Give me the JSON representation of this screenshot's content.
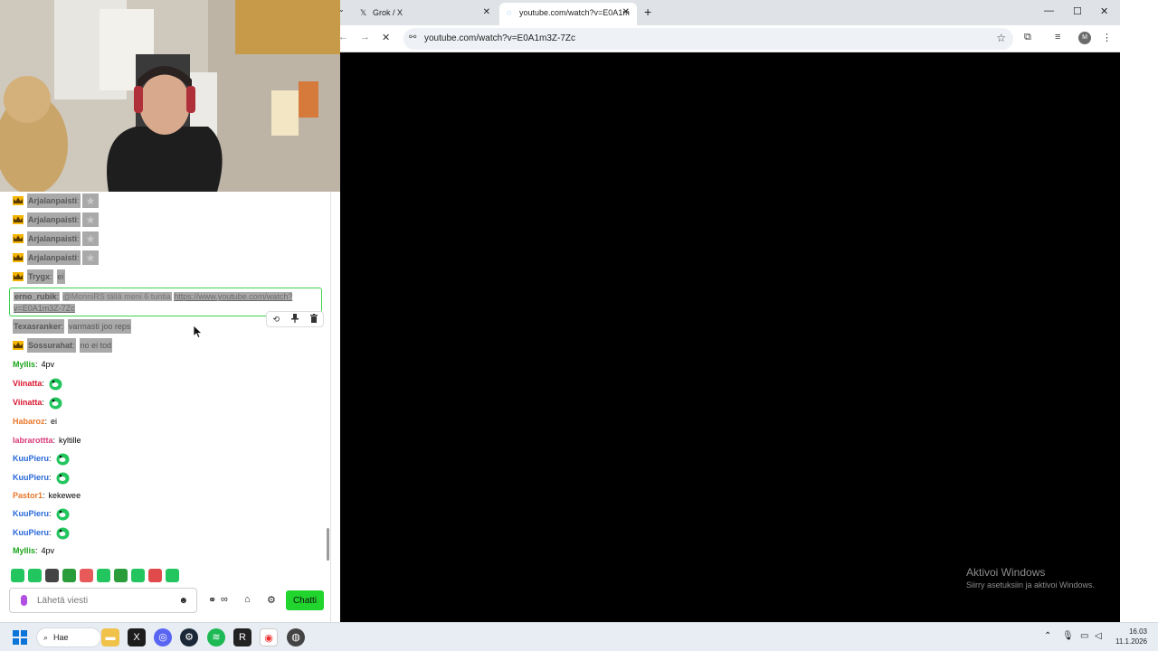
{
  "chat": {
    "messages": [
      {
        "user": "Arjalanpaisti",
        "sep": ":",
        "text": "",
        "emote": "star-emote",
        "crown": true,
        "highlight": true
      },
      {
        "user": "Arjalanpaisti",
        "sep": ":",
        "text": "",
        "emote": "star-emote",
        "crown": true,
        "highlight": true
      },
      {
        "user": "Arjalanpaisti",
        "sep": ":",
        "text": "",
        "emote": "star-emote",
        "crown": true,
        "highlight": true
      },
      {
        "user": "Arjalanpaisti",
        "sep": ":",
        "text": "",
        "emote": "star-emote",
        "crown": true,
        "highlight": true
      },
      {
        "user": "Trygx",
        "sep": ":",
        "text": "ei",
        "crown": true,
        "highlight": true
      },
      {
        "user": "Texasranker",
        "sep": ":",
        "text": "varmasti joo reps",
        "crown": false,
        "highlight": true
      },
      {
        "user": "Sossurahat",
        "sep": ":",
        "text": "no ei tod",
        "crown": true,
        "highlight": true
      },
      {
        "user": "Myllis",
        "sep": ":",
        "text": "4pv",
        "color": "#1aa51a"
      },
      {
        "user": "Viinatta",
        "sep": ":",
        "text": "",
        "emote": "pepega-emote",
        "color": "#d8142e"
      },
      {
        "user": "Viinatta",
        "sep": ":",
        "text": "",
        "emote": "pepega-emote",
        "color": "#d8142e"
      },
      {
        "user": "Habaroz",
        "sep": ":",
        "text": "ei",
        "color": "#e8772a"
      },
      {
        "user": "labrarottta",
        "sep": ":",
        "text": "kyltille",
        "color": "#d83a7a"
      },
      {
        "user": "KuuPieru",
        "sep": ":",
        "text": "",
        "emote": "pepega-emote",
        "color": "#2a6ad8"
      },
      {
        "user": "KuuPieru",
        "sep": ":",
        "text": "",
        "emote": "pepega-emote",
        "color": "#2a6ad8"
      },
      {
        "user": "Pastor1",
        "sep": ":",
        "text": "kekewee",
        "color": "#e8772a"
      },
      {
        "user": "KuuPieru",
        "sep": ":",
        "text": "",
        "emote": "pepega-emote",
        "color": "#2a6ad8"
      },
      {
        "user": "KuuPieru",
        "sep": ":",
        "text": "",
        "emote": "pepega-emote",
        "color": "#2a6ad8"
      },
      {
        "user": "Myllis",
        "sep": ":",
        "text": "4pv",
        "color": "#1aa51a"
      }
    ],
    "pinned": {
      "user": "erno_rubik",
      "sep": ":",
      "text": "@MonniRS tällä meni 6 tuntia",
      "link_part1": "https://www.youtube.com/watch?",
      "link_part2": "v=E0A1m3Z-7Zc"
    },
    "actions": {
      "undo": "⟲",
      "pin": "📌",
      "delete": "🗑"
    },
    "emote_bar": [
      "#22c55e",
      "#22c55e",
      "#444444",
      "#2a9d3a",
      "#e85a5a",
      "#22c55e",
      "#2a9d3a",
      "#22c55e",
      "#e04a4a",
      "#22c55e"
    ],
    "input_placeholder": "Lähetä viesti",
    "send_label": "Chatti"
  },
  "browser": {
    "tabs": [
      {
        "title": "Grok / X",
        "icon": "x-logo-icon"
      },
      {
        "title": "youtube.com/watch?v=E0A1m",
        "icon": "loading-icon",
        "active": true
      }
    ],
    "url": "youtube.com/watch?v=E0A1m3Z-7Zc",
    "profile_initial": "M"
  },
  "watermark": {
    "title": "Aktivoi Windows",
    "subtitle": "Siirry asetuksiin ja aktivoi Windows."
  },
  "taskbar": {
    "search_label": "Hae",
    "time": "16.03",
    "date": "11.1.2026"
  },
  "colors": {
    "accent_green": "#22d42e",
    "highlight_gray": "#a9a9a9",
    "tab_bar": "#dfe3e8",
    "taskbar": "#e8edf4"
  }
}
